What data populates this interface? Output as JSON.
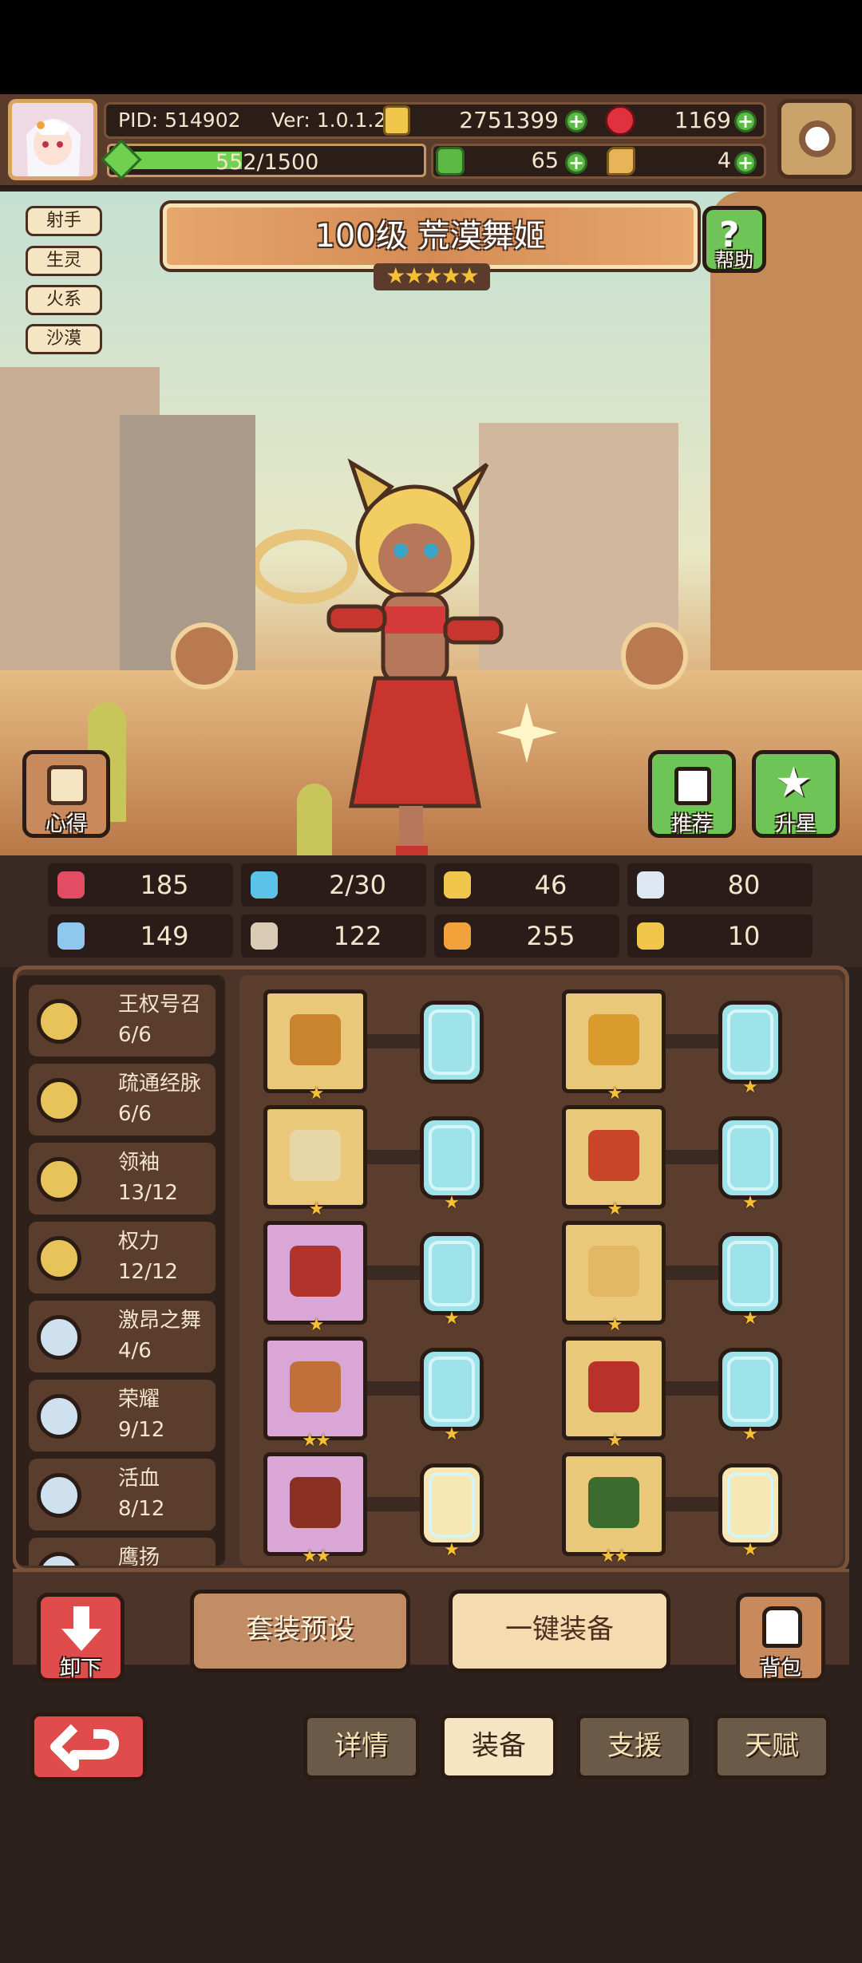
{
  "header": {
    "pid": "PID: 514902",
    "version": "Ver: 1.0.1.2",
    "gold": "2751399",
    "gems": "1169",
    "exp": "552/1500",
    "clover": "65",
    "keys": "4"
  },
  "tags": [
    "射手",
    "生灵",
    "火系",
    "沙漠"
  ],
  "hero": {
    "title": "100级  荒漠舞姬",
    "stars": "★★★★★"
  },
  "buttons": {
    "help": "帮助",
    "insight": "心得",
    "recommend": "推荐",
    "star_up": "升星",
    "unequip": "卸下",
    "set_preset": "套装预设",
    "auto_equip": "一键装备",
    "backpack": "背包"
  },
  "stats": [
    {
      "icon": "heart-icon",
      "value": "185",
      "color": "#e34d63"
    },
    {
      "icon": "water-drop-icon",
      "value": "2/30",
      "color": "#5bc3e8"
    },
    {
      "icon": "shield-icon",
      "value": "46",
      "color": "#f0c64b"
    },
    {
      "icon": "wing-icon",
      "value": "80",
      "color": "#dfe7f3"
    },
    {
      "icon": "fist-icon",
      "value": "149",
      "color": "#8fc7ee"
    },
    {
      "icon": "book-icon",
      "value": "122",
      "color": "#d9cbb6"
    },
    {
      "icon": "crate-icon",
      "value": "255",
      "color": "#f2a23a"
    },
    {
      "icon": "horseshoe-icon",
      "value": "10",
      "color": "#f0c64b"
    }
  ],
  "talents": [
    {
      "name": "王权号召",
      "progress": "6/6",
      "tier": "gold"
    },
    {
      "name": "疏通经脉",
      "progress": "6/6",
      "tier": "gold"
    },
    {
      "name": "领袖",
      "progress": "13/12",
      "tier": "gold"
    },
    {
      "name": "权力",
      "progress": "12/12",
      "tier": "gold"
    },
    {
      "name": "激昂之舞",
      "progress": "4/6",
      "tier": "silver"
    },
    {
      "name": "荣耀",
      "progress": "9/12",
      "tier": "silver"
    },
    {
      "name": "活血",
      "progress": "8/12",
      "tier": "silver"
    },
    {
      "name": "鹰扬",
      "progress": "",
      "tier": "silver"
    }
  ],
  "equipment": [
    {
      "item": "scepter",
      "stars": "★",
      "bg": "gold",
      "gem_stars": "",
      "gem_color": "#9fe3ea",
      "item_color": "#c9842d"
    },
    {
      "item": "crown",
      "stars": "★",
      "bg": "gold",
      "gem_stars": "★",
      "gem_color": "#9fe3ea",
      "item_color": "#d99a2e"
    },
    {
      "item": "spear",
      "stars": "★",
      "bg": "gold",
      "gem_stars": "★",
      "gem_color": "#9fe3ea",
      "item_color": "#e7d7a6"
    },
    {
      "item": "robe",
      "stars": "★",
      "bg": "gold",
      "gem_stars": "★",
      "gem_color": "#9fe3ea",
      "item_color": "#c8452a"
    },
    {
      "item": "necklace",
      "stars": "★",
      "bg": "purple",
      "gem_stars": "★",
      "gem_color": "#9fe3ea",
      "item_color": "#b0342c"
    },
    {
      "item": "sun-ring",
      "stars": "★",
      "bg": "gold",
      "gem_stars": "★",
      "gem_color": "#9fe3ea",
      "item_color": "#e3b766"
    },
    {
      "item": "orb",
      "stars": "★★",
      "bg": "purple",
      "gem_stars": "★",
      "gem_color": "#9fe3ea",
      "item_color": "#c2703a"
    },
    {
      "item": "belt",
      "stars": "★",
      "bg": "gold",
      "gem_stars": "★",
      "gem_color": "#9fe3ea",
      "item_color": "#b8322b"
    },
    {
      "item": "lips",
      "stars": "★★",
      "bg": "purple",
      "gem_stars": "★",
      "gem_color": "#f6e7b4",
      "item_color": "#8a2f22"
    },
    {
      "item": "boots",
      "stars": "★★",
      "bg": "gold",
      "gem_stars": "★",
      "gem_color": "#f6e7b4",
      "item_color": "#3d6b2e"
    }
  ],
  "tabs": [
    "详情",
    "装备",
    "支援",
    "天赋"
  ],
  "active_tab": "装备"
}
